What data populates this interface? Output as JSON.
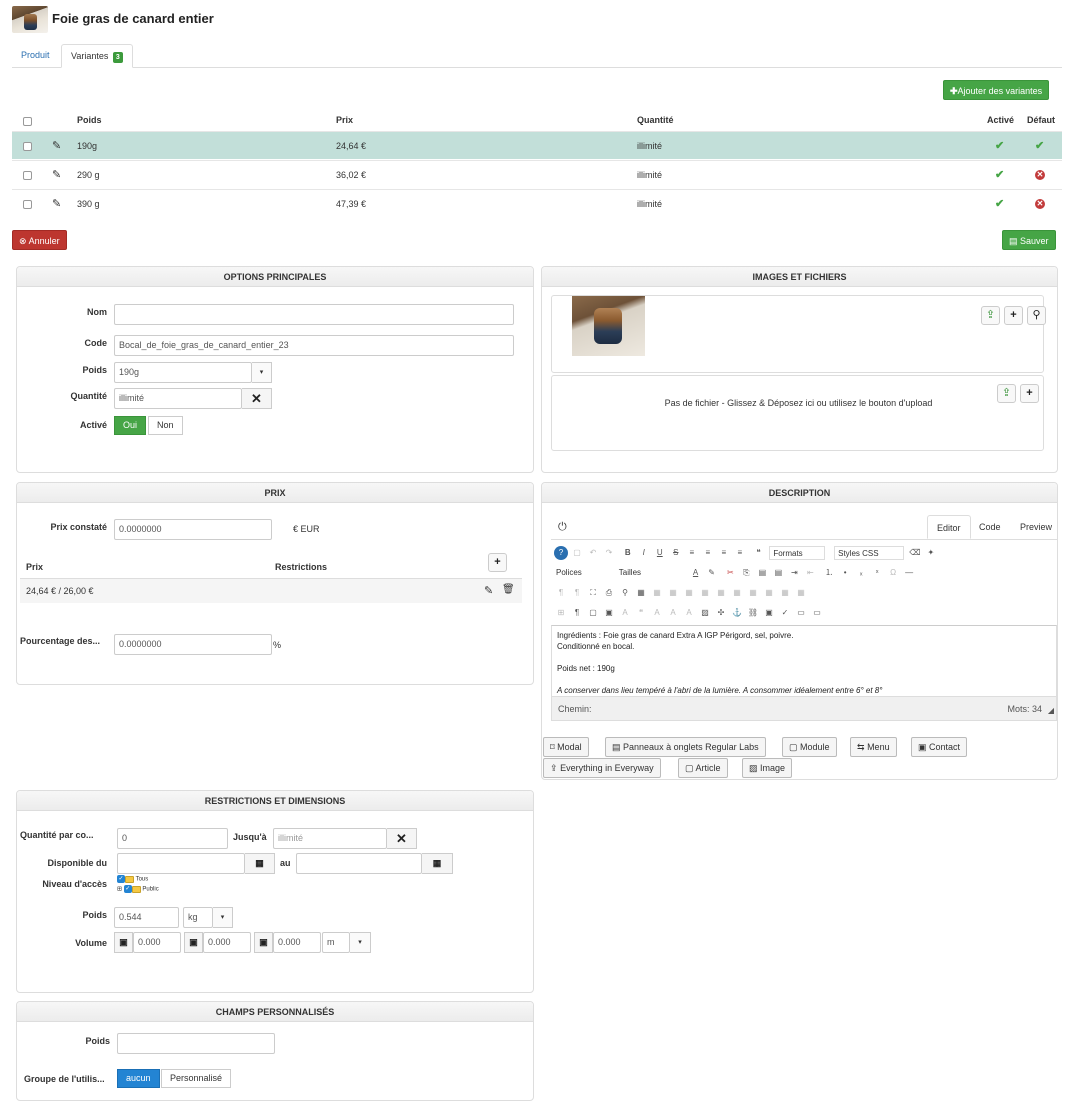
{
  "product": {
    "title": "Foie gras de canard entier"
  },
  "tabs": [
    {
      "label": "Produit"
    },
    {
      "label": "Variantes",
      "badge": "3"
    }
  ],
  "actions": {
    "add_variants": "Ajouter des variantes",
    "cancel": "Annuler",
    "save": "Sauver"
  },
  "variants": {
    "headers": {
      "poids": "Poids",
      "prix": "Prix",
      "quantite": "Quantité",
      "active": "Activé",
      "default": "Défaut"
    },
    "rows": [
      {
        "poids": "190g",
        "prix": "24,64 €",
        "quantite": "illimité",
        "active": true,
        "default": true,
        "selected": true
      },
      {
        "poids": "290 g",
        "prix": "36,02 €",
        "quantite": "illimité",
        "active": true,
        "default": false
      },
      {
        "poids": "390 g",
        "prix": "47,39 €",
        "quantite": "illimité",
        "active": true,
        "default": false
      }
    ]
  },
  "options": {
    "title": "OPTIONS PRINCIPALES",
    "nom_label": "Nom",
    "nom_value": "",
    "code_label": "Code",
    "code_value": "Bocal_de_foie_gras_de_canard_entier_23",
    "poids_label": "Poids",
    "poids_value": "190g",
    "quantite_label": "Quantité",
    "quantite_value": "illimité",
    "active_label": "Activé",
    "oui": "Oui",
    "non": "Non"
  },
  "images": {
    "title": "IMAGES ET FICHIERS",
    "empty_files": "Pas de fichier - Glissez & Déposez ici ou utilisez le bouton d'upload"
  },
  "prix": {
    "title": "PRIX",
    "prix_constate_label": "Prix constaté",
    "prix_constate_value": "0.0000000",
    "currency": "€ EUR",
    "col_prix": "Prix",
    "col_restrictions": "Restrictions",
    "row_price": "24,64 € / 26,00 €",
    "pourcentage_label": "Pourcentage des...",
    "pourcentage_value": "0.0000000",
    "pct": "%"
  },
  "description": {
    "title": "DESCRIPTION",
    "tabs": [
      "Editor",
      "Code",
      "Preview"
    ],
    "formats": "Formats",
    "styles": "Styles CSS",
    "polices": "Polices",
    "tailles": "Tailles",
    "lines": [
      "Ingrédients : Foie gras de canard Extra A IGP Périgord, sel, poivre.",
      "Conditionné en bocal.",
      "Poids net : 190g",
      "A conserver dans lieu tempéré à l'abri de la lumière. A consommer idéalement entre 6° et 8°"
    ],
    "path_label": "Chemin:",
    "words_label": "Mots:",
    "words_count": "34",
    "buttons": [
      "Modal",
      "Panneaux à onglets Regular Labs",
      "Module",
      "Menu",
      "Contact",
      "Everything in Everyway",
      "Article",
      "Image"
    ]
  },
  "restrictions": {
    "title": "RESTRICTIONS ET DIMENSIONS",
    "qty_label": "Quantité par co...",
    "qty_value": "0",
    "jusqua_label": "Jusqu'à",
    "jusqua_placeholder": "illimité",
    "dispo_label": "Disponible du",
    "au_label": "au",
    "acces_label": "Niveau d'accès",
    "acces_tous": "Tous",
    "acces_public": "Public",
    "poids_label": "Poids",
    "poids_value": "0.544",
    "poids_unit": "kg",
    "volume_label": "Volume",
    "vol_x": "0.000",
    "vol_y": "0.000",
    "vol_z": "0.000",
    "vol_unit": "m"
  },
  "custom": {
    "title": "CHAMPS PERSONNALISÉS",
    "poids_label": "Poids",
    "poids_value": "",
    "groupe_label": "Groupe de l'utilis...",
    "aucun": "aucun",
    "perso": "Personnalisé"
  }
}
